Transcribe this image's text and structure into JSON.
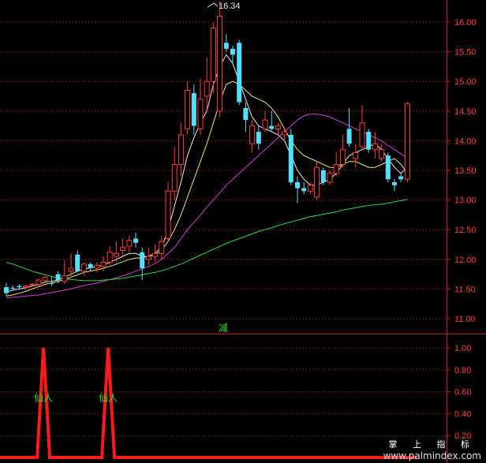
{
  "chart_data": [
    {
      "type": "candlestick",
      "panel": "price",
      "ylim": [
        10.8,
        16.3
      ],
      "yticks": [
        "16.00",
        "15.50",
        "15.00",
        "14.50",
        "14.00",
        "13.50",
        "13.00",
        "12.50",
        "12.00",
        "11.50",
        "11.00"
      ],
      "peak_label": "16.34",
      "marker_text": "减",
      "candles": [
        {
          "o": 11.53,
          "h": 11.6,
          "l": 11.38,
          "c": 11.43,
          "up": false
        },
        {
          "o": 11.52,
          "h": 11.56,
          "l": 11.47,
          "c": 11.52,
          "up": false
        },
        {
          "o": 11.55,
          "h": 11.58,
          "l": 11.49,
          "c": 11.53,
          "up": false
        },
        {
          "o": 11.53,
          "h": 11.57,
          "l": 11.48,
          "c": 11.55,
          "up": true
        },
        {
          "o": 11.57,
          "h": 11.6,
          "l": 11.54,
          "c": 11.58,
          "up": true
        },
        {
          "o": 11.58,
          "h": 11.68,
          "l": 11.55,
          "c": 11.65,
          "up": true
        },
        {
          "o": 11.65,
          "h": 11.72,
          "l": 11.6,
          "c": 11.7,
          "up": true
        },
        {
          "o": 11.6,
          "h": 11.7,
          "l": 11.55,
          "c": 11.6,
          "up": false
        },
        {
          "o": 11.75,
          "h": 11.8,
          "l": 11.6,
          "c": 11.65,
          "up": false
        },
        {
          "o": 11.63,
          "h": 11.98,
          "l": 11.58,
          "c": 11.72,
          "up": true
        },
        {
          "o": 11.8,
          "h": 12.1,
          "l": 11.7,
          "c": 11.85,
          "up": true
        },
        {
          "o": 12.08,
          "h": 12.15,
          "l": 11.78,
          "c": 11.8,
          "up": false
        },
        {
          "o": 11.8,
          "h": 11.95,
          "l": 11.73,
          "c": 11.92,
          "up": true
        },
        {
          "o": 11.92,
          "h": 11.95,
          "l": 11.8,
          "c": 11.85,
          "up": false
        },
        {
          "o": 11.85,
          "h": 11.95,
          "l": 11.78,
          "c": 11.9,
          "up": true
        },
        {
          "o": 11.88,
          "h": 12.05,
          "l": 11.8,
          "c": 11.95,
          "up": true
        },
        {
          "o": 11.95,
          "h": 12.22,
          "l": 11.9,
          "c": 12.12,
          "up": true
        },
        {
          "o": 12.05,
          "h": 12.3,
          "l": 11.95,
          "c": 12.1,
          "up": true
        },
        {
          "o": 12.15,
          "h": 12.35,
          "l": 12.05,
          "c": 12.2,
          "up": true
        },
        {
          "o": 12.22,
          "h": 12.4,
          "l": 12.12,
          "c": 12.32,
          "up": true
        },
        {
          "o": 12.35,
          "h": 12.45,
          "l": 12.2,
          "c": 12.28,
          "up": false
        },
        {
          "o": 12.12,
          "h": 12.2,
          "l": 11.65,
          "c": 11.85,
          "up": false
        },
        {
          "o": 12.0,
          "h": 12.2,
          "l": 11.9,
          "c": 12.05,
          "up": true
        },
        {
          "o": 12.05,
          "h": 12.25,
          "l": 11.95,
          "c": 12.1,
          "up": true
        },
        {
          "o": 12.1,
          "h": 12.4,
          "l": 12.0,
          "c": 12.3,
          "up": true
        },
        {
          "o": 12.35,
          "h": 13.3,
          "l": 12.3,
          "c": 13.15,
          "up": true
        },
        {
          "o": 13.15,
          "h": 13.9,
          "l": 13.0,
          "c": 13.6,
          "up": true
        },
        {
          "o": 13.6,
          "h": 14.3,
          "l": 13.4,
          "c": 14.1,
          "up": true
        },
        {
          "o": 14.2,
          "h": 15.0,
          "l": 14.1,
          "c": 14.85,
          "up": true
        },
        {
          "o": 14.8,
          "h": 14.95,
          "l": 14.1,
          "c": 14.25,
          "up": false
        },
        {
          "o": 14.2,
          "h": 15.05,
          "l": 14.1,
          "c": 14.7,
          "up": true
        },
        {
          "o": 14.75,
          "h": 15.4,
          "l": 14.5,
          "c": 15.0,
          "up": true
        },
        {
          "o": 15.0,
          "h": 16.0,
          "l": 14.8,
          "c": 15.9,
          "up": true
        },
        {
          "o": 14.5,
          "h": 16.34,
          "l": 14.4,
          "c": 16.1,
          "up": true
        },
        {
          "o": 15.65,
          "h": 15.8,
          "l": 15.5,
          "c": 15.55,
          "up": false
        },
        {
          "o": 15.55,
          "h": 15.6,
          "l": 15.3,
          "c": 15.45,
          "up": false
        },
        {
          "o": 15.65,
          "h": 15.7,
          "l": 14.6,
          "c": 14.65,
          "up": false
        },
        {
          "o": 14.55,
          "h": 14.65,
          "l": 14.15,
          "c": 14.35,
          "up": false
        },
        {
          "o": 14.25,
          "h": 14.35,
          "l": 13.8,
          "c": 13.95,
          "up": true
        },
        {
          "o": 14.15,
          "h": 14.25,
          "l": 13.85,
          "c": 13.95,
          "up": false
        },
        {
          "o": 14.2,
          "h": 14.5,
          "l": 14.15,
          "c": 14.35,
          "up": true
        },
        {
          "o": 14.25,
          "h": 14.5,
          "l": 14.15,
          "c": 14.2,
          "up": false
        },
        {
          "o": 14.2,
          "h": 14.3,
          "l": 14.1,
          "c": 14.25,
          "up": true
        },
        {
          "o": 14.1,
          "h": 14.2,
          "l": 14.0,
          "c": 14.15,
          "up": true
        },
        {
          "o": 14.1,
          "h": 14.2,
          "l": 13.25,
          "c": 13.3,
          "up": false
        },
        {
          "o": 13.3,
          "h": 13.4,
          "l": 12.95,
          "c": 13.2,
          "up": false
        },
        {
          "o": 13.2,
          "h": 13.3,
          "l": 13.1,
          "c": 13.15,
          "up": false
        },
        {
          "o": 13.15,
          "h": 13.3,
          "l": 13.1,
          "c": 13.25,
          "up": true
        },
        {
          "o": 13.05,
          "h": 13.65,
          "l": 13.0,
          "c": 13.55,
          "up": true
        },
        {
          "o": 13.5,
          "h": 13.55,
          "l": 13.25,
          "c": 13.3,
          "up": false
        },
        {
          "o": 13.3,
          "h": 13.5,
          "l": 13.25,
          "c": 13.45,
          "up": true
        },
        {
          "o": 13.45,
          "h": 13.8,
          "l": 13.4,
          "c": 13.6,
          "up": true
        },
        {
          "o": 13.6,
          "h": 14.1,
          "l": 13.55,
          "c": 13.85,
          "up": true
        },
        {
          "o": 14.2,
          "h": 14.55,
          "l": 13.9,
          "c": 13.95,
          "up": false
        },
        {
          "o": 13.8,
          "h": 13.95,
          "l": 13.55,
          "c": 13.7,
          "up": true
        },
        {
          "o": 13.9,
          "h": 14.6,
          "l": 13.85,
          "c": 14.3,
          "up": true
        },
        {
          "o": 14.15,
          "h": 14.2,
          "l": 13.8,
          "c": 13.85,
          "up": false
        },
        {
          "o": 13.95,
          "h": 14.15,
          "l": 13.7,
          "c": 13.85,
          "up": true
        },
        {
          "o": 13.85,
          "h": 13.95,
          "l": 13.65,
          "c": 13.7,
          "up": true
        },
        {
          "o": 13.75,
          "h": 13.8,
          "l": 13.3,
          "c": 13.35,
          "up": false
        },
        {
          "o": 13.3,
          "h": 13.35,
          "l": 13.15,
          "c": 13.25,
          "up": false
        },
        {
          "o": 13.35,
          "h": 13.45,
          "l": 13.3,
          "c": 13.4,
          "up": false
        },
        {
          "o": 13.35,
          "h": 14.65,
          "l": 13.3,
          "c": 14.62,
          "up": true
        }
      ],
      "series": [
        {
          "style": "ma-white",
          "color": "#e8e8e8",
          "values": [
            11.45,
            11.48,
            11.5,
            11.52,
            11.55,
            11.58,
            11.62,
            11.63,
            11.65,
            11.7,
            11.75,
            11.8,
            11.83,
            11.86,
            11.88,
            11.9,
            11.95,
            12.0,
            12.05,
            12.1,
            12.1,
            12.05,
            12.05,
            12.1,
            12.2,
            12.5,
            12.9,
            13.3,
            13.75,
            14.05,
            14.3,
            14.5,
            14.95,
            15.25,
            15.45,
            15.3,
            15.0,
            14.7,
            14.4,
            14.25,
            14.2,
            14.15,
            14.1,
            14.0,
            13.75,
            13.5,
            13.35,
            13.25,
            13.25,
            13.3,
            13.35,
            13.45,
            13.6,
            13.75,
            13.8,
            13.85,
            13.9,
            13.95,
            13.85,
            13.7,
            13.55,
            13.45,
            13.55
          ]
        },
        {
          "style": "ma-yellow",
          "color": "#e8e860",
          "values": [
            11.38,
            11.4,
            11.43,
            11.46,
            11.5,
            11.54,
            11.58,
            11.6,
            11.63,
            11.66,
            11.7,
            11.74,
            11.78,
            11.8,
            11.82,
            11.85,
            11.88,
            11.92,
            11.96,
            12.0,
            12.02,
            12.03,
            12.05,
            12.08,
            12.15,
            12.3,
            12.5,
            12.75,
            13.05,
            13.35,
            13.65,
            13.95,
            14.3,
            14.65,
            14.95,
            15.0,
            14.95,
            14.85,
            14.75,
            14.7,
            14.65,
            14.55,
            14.4,
            14.2,
            14.0,
            13.85,
            13.75,
            13.7,
            13.65,
            13.6,
            13.55,
            13.55,
            13.6,
            13.65,
            13.65,
            13.6,
            13.55,
            13.55,
            13.6,
            13.65,
            13.7,
            13.6,
            13.45
          ]
        },
        {
          "style": "ma-magenta",
          "color": "#d63bd6",
          "values": [
            11.35,
            11.36,
            11.37,
            11.38,
            11.39,
            11.4,
            11.42,
            11.44,
            11.46,
            11.48,
            11.5,
            11.53,
            11.56,
            11.58,
            11.6,
            11.63,
            11.66,
            11.69,
            11.72,
            11.76,
            11.8,
            11.84,
            11.88,
            11.93,
            12.0,
            12.1,
            12.2,
            12.35,
            12.5,
            12.62,
            12.75,
            12.88,
            13.0,
            13.12,
            13.25,
            13.35,
            13.45,
            13.55,
            13.65,
            13.75,
            13.85,
            13.95,
            14.05,
            14.15,
            14.25,
            14.35,
            14.42,
            14.45,
            14.45,
            14.43,
            14.4,
            14.35,
            14.3,
            14.25,
            14.2,
            14.15,
            14.1,
            14.05,
            14.0,
            13.92,
            13.85,
            13.78,
            13.7
          ]
        },
        {
          "style": "ma-green",
          "color": "#2edb2e",
          "values": [
            11.95,
            11.92,
            11.88,
            11.84,
            11.8,
            11.77,
            11.74,
            11.71,
            11.69,
            11.67,
            11.66,
            11.65,
            11.64,
            11.64,
            11.64,
            11.65,
            11.66,
            11.67,
            11.68,
            11.7,
            11.72,
            11.74,
            11.76,
            11.78,
            11.81,
            11.84,
            11.88,
            11.92,
            11.97,
            12.02,
            12.07,
            12.12,
            12.17,
            12.22,
            12.27,
            12.31,
            12.35,
            12.39,
            12.43,
            12.47,
            12.5,
            12.53,
            12.57,
            12.6,
            12.63,
            12.66,
            12.69,
            12.72,
            12.74,
            12.76,
            12.78,
            12.8,
            12.83,
            12.85,
            12.87,
            12.89,
            12.91,
            12.92,
            12.93,
            12.95,
            12.97,
            12.99,
            13.01
          ]
        }
      ]
    },
    {
      "type": "line",
      "panel": "indicator",
      "ylim": [
        0,
        1.1
      ],
      "yticks": [
        "1.00",
        "0.80",
        "0.60",
        "0.40",
        "0.20"
      ],
      "color": "#ff1a1a",
      "pulses": [
        6,
        16
      ],
      "labels": [
        {
          "text": "仙人",
          "at": 6,
          "level": 0.5
        },
        {
          "text": "仙人",
          "at": 16,
          "level": 0.5
        }
      ]
    }
  ],
  "watermark": {
    "line1": "掌 上 指 标",
    "line2": "www.palmindex.com"
  }
}
